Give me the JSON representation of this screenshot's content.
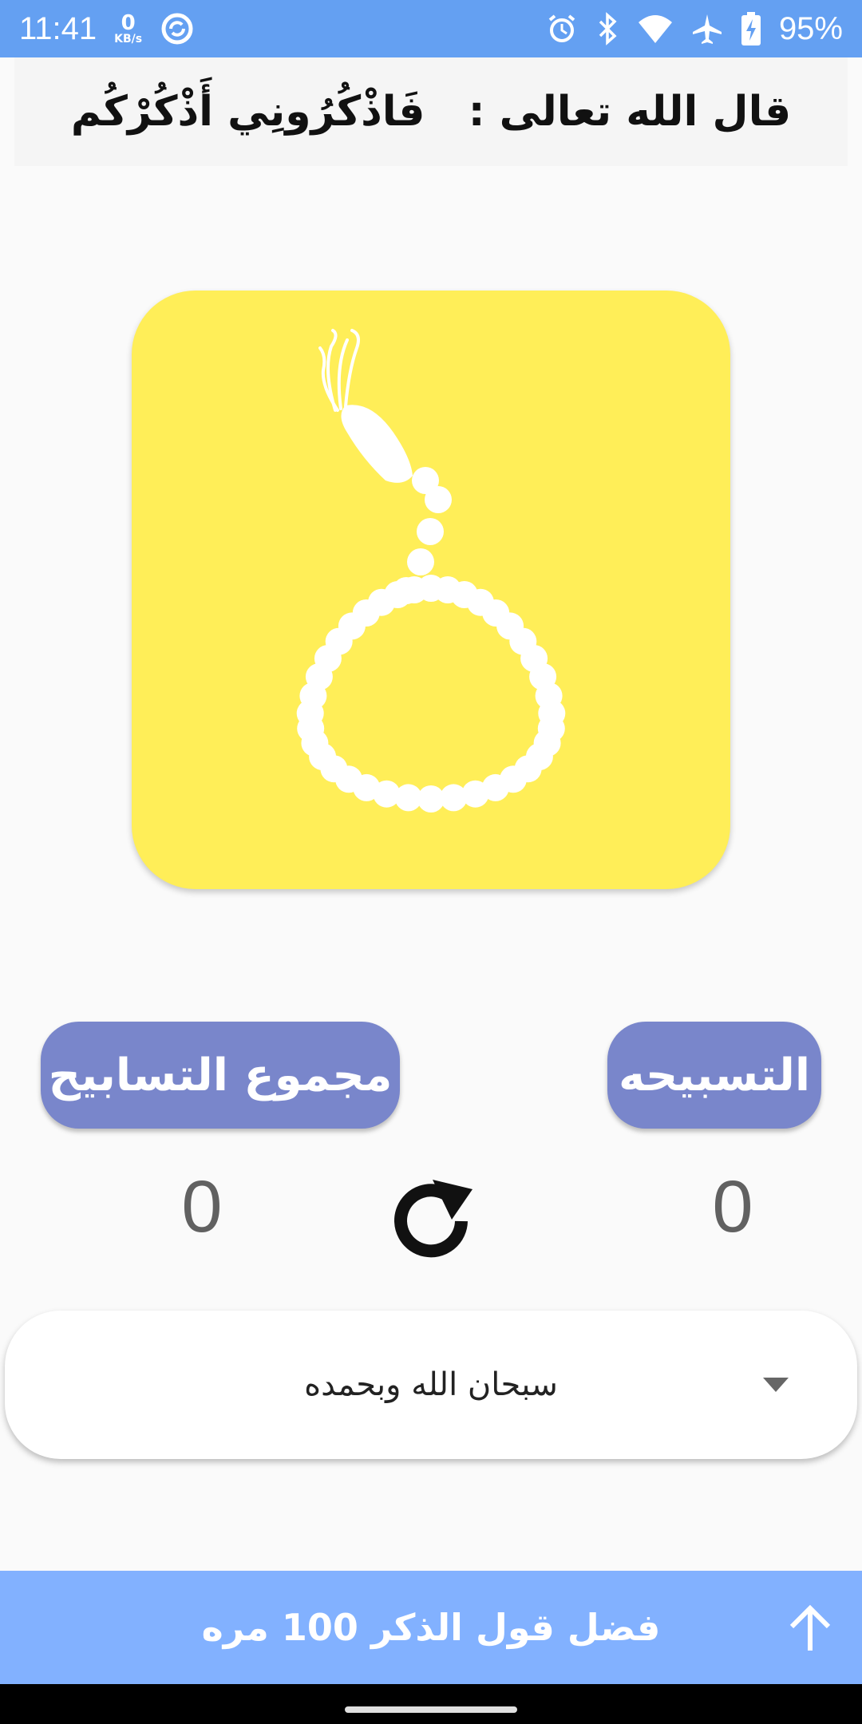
{
  "status_bar": {
    "time": "11:41",
    "net_speed_value": "0",
    "net_speed_unit": "KB/s",
    "battery": "95%",
    "icons": [
      "sync-icon",
      "alarm-icon",
      "bluetooth-icon",
      "wifi-icon",
      "airplane-icon",
      "battery-charging-icon"
    ]
  },
  "header": {
    "verse": "قال الله تعالى :   فَاذْكُرُونِي أَذْكُرْكُم"
  },
  "rosary": {
    "icon": "rosary-beads-icon",
    "background": "#ffee58"
  },
  "buttons": {
    "total_label": "مجموع التسابيح",
    "tasbih_label": "التسبيحه",
    "color": "#7986cb"
  },
  "counters": {
    "total": "0",
    "tasbih": "0"
  },
  "dhikr_select": {
    "selected": "سبحان الله وبحمده"
  },
  "bottom_bar": {
    "label": "فضل قول الذكر 100 مره",
    "color": "#82b1ff"
  },
  "colors": {
    "status_bar": "#64a0f2",
    "background": "#fafafa"
  }
}
